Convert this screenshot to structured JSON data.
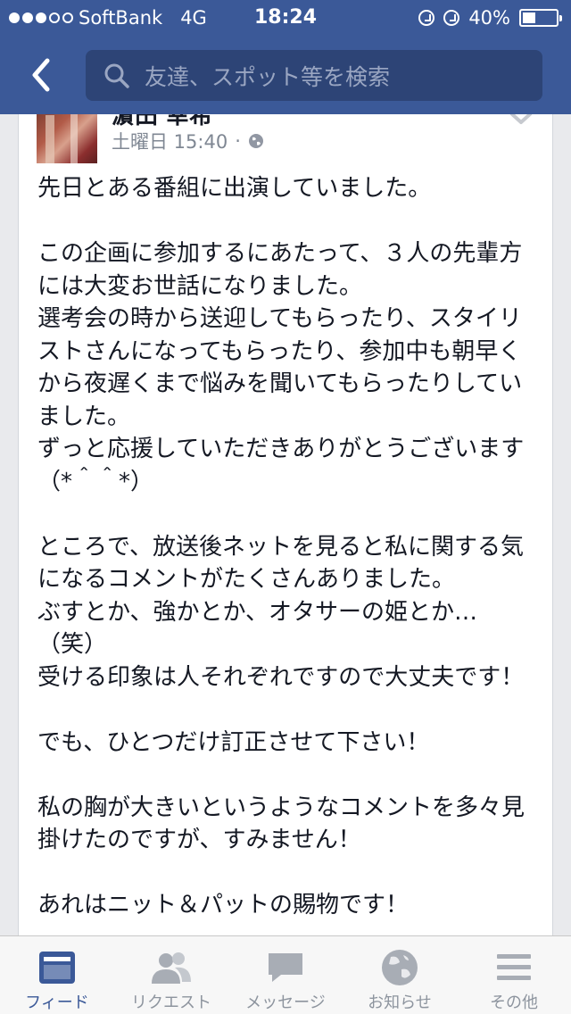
{
  "status_bar": {
    "signal_filled": 3,
    "signal_total": 5,
    "carrier": "SoftBank",
    "network": "4G",
    "time": "18:24",
    "battery_text": "40%",
    "battery_level": 0.4
  },
  "nav": {
    "back_icon": "chevron-left-icon",
    "search_placeholder": "友達、スポット等を検索"
  },
  "post": {
    "author": "濵田 幸希",
    "timestamp": "土曜日 15:40",
    "privacy_icon": "globe-icon",
    "body": "先日とある番組に出演していました。\n\nこの企画に参加するにあたって、３人の先輩方には大変お世話になりました。\n選考会の時から送迎してもらったり、スタイリストさんになってもらったり、参加中も朝早くから夜遅くまで悩みを聞いてもらったりしていました。\nずっと応援していただきありがとうございます（*＾＾*）\n\nところで、放送後ネットを見ると私に関する気になるコメントがたくさんありました。\nぶすとか、強かとか、オタサーの姫とか…（笑）\n受ける印象は人それぞれですので大丈夫です！\n\nでも、ひとつだけ訂正させて下さい！\n\n私の胸が大きいというようなコメントを多々見掛けたのですが、すみません！\n\nあれはニット＆パットの賜物です！"
  },
  "tabs": [
    {
      "label": "フィード",
      "icon": "news-feed-icon",
      "active": true
    },
    {
      "label": "リクエスト",
      "icon": "friend-requests-icon",
      "active": false
    },
    {
      "label": "メッセージ",
      "icon": "messages-icon",
      "active": false
    },
    {
      "label": "お知らせ",
      "icon": "notifications-globe-icon",
      "active": false
    },
    {
      "label": "その他",
      "icon": "more-menu-icon",
      "active": false
    }
  ],
  "colors": {
    "brand": "#3b5998",
    "active_tab": "#3b5998",
    "inactive_tab": "#8d949e",
    "meta_text": "#7f8793"
  }
}
